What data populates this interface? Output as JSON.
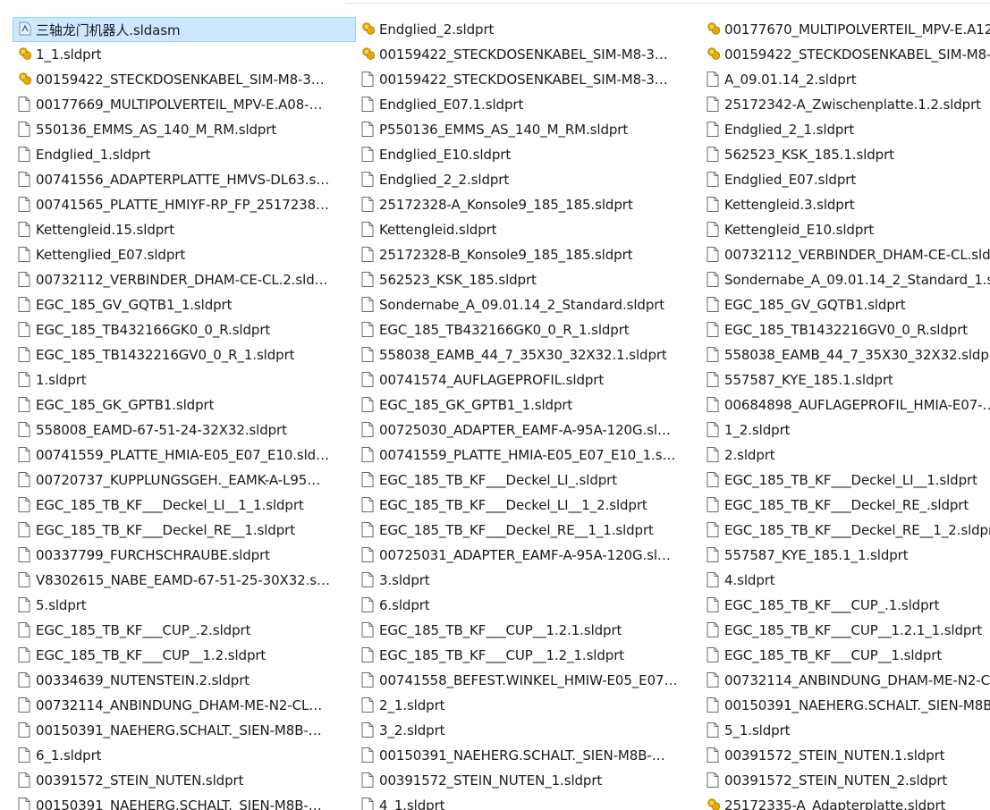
{
  "colors": {
    "selection_bg": "#cce8ff",
    "selection_border": "#99d1ff",
    "assembly_icon": "#e8a800",
    "part_icon_stroke": "#6b6b6b"
  },
  "files": [
    {
      "name": "三轴龙门机器人.sldasm",
      "icon": "assembly-file-icon",
      "selected": true
    },
    {
      "name": "1_1.sldprt",
      "icon": "assembly-file-icon"
    },
    {
      "name": "00159422_STECKDOSENKABEL_SIM-M8-3…",
      "icon": "assembly-file-icon"
    },
    {
      "name": "00177669_MULTIPOLVERTEIL_MPV-E.A08-…",
      "icon": "part-file-icon"
    },
    {
      "name": "550136_EMMS_AS_140_M_RM.sldprt",
      "icon": "part-file-icon"
    },
    {
      "name": "Endglied_1.sldprt",
      "icon": "part-file-icon"
    },
    {
      "name": "00741556_ADAPTERPLATTE_HMVS-DL63.s…",
      "icon": "part-file-icon"
    },
    {
      "name": "00741565_PLATTE_HMIYF-RP_FP_2517238…",
      "icon": "part-file-icon"
    },
    {
      "name": "Kettengleid.15.sldprt",
      "icon": "part-file-icon"
    },
    {
      "name": "Kettenglied_E07.sldprt",
      "icon": "part-file-icon"
    },
    {
      "name": "00732112_VERBINDER_DHAM-CE-CL.2.sld…",
      "icon": "part-file-icon"
    },
    {
      "name": "EGC_185_GV_GQTB1_1.sldprt",
      "icon": "part-file-icon"
    },
    {
      "name": "EGC_185_TB432166GK0_0_R.sldprt",
      "icon": "part-file-icon"
    },
    {
      "name": "EGC_185_TB1432216GV0_0_R_1.sldprt",
      "icon": "part-file-icon"
    },
    {
      "name": "1.sldprt",
      "icon": "part-file-icon"
    },
    {
      "name": "EGC_185_GK_GPTB1.sldprt",
      "icon": "part-file-icon"
    },
    {
      "name": "558008_EAMD-67-51-24-32X32.sldprt",
      "icon": "part-file-icon"
    },
    {
      "name": "00741559_PLATTE_HMIA-E05_E07_E10.sld…",
      "icon": "part-file-icon"
    },
    {
      "name": "00720737_KUPPLUNGSGEH._EAMK-A-L95…",
      "icon": "part-file-icon"
    },
    {
      "name": "EGC_185_TB_KF___Deckel_LI__1_1.sldprt",
      "icon": "part-file-icon"
    },
    {
      "name": "EGC_185_TB_KF___Deckel_RE__1.sldprt",
      "icon": "part-file-icon"
    },
    {
      "name": "00337799_FURCHSCHRAUBE.sldprt",
      "icon": "part-file-icon"
    },
    {
      "name": "V8302615_NABE_EAMD-67-51-25-30X32.s…",
      "icon": "part-file-icon"
    },
    {
      "name": "5.sldprt",
      "icon": "part-file-icon"
    },
    {
      "name": "EGC_185_TB_KF___CUP_.2.sldprt",
      "icon": "part-file-icon"
    },
    {
      "name": "EGC_185_TB_KF___CUP__1.2.sldprt",
      "icon": "part-file-icon"
    },
    {
      "name": "00334639_NUTENSTEIN.2.sldprt",
      "icon": "part-file-icon"
    },
    {
      "name": "00732114_ANBINDUNG_DHAM-ME-N2-CL…",
      "icon": "part-file-icon"
    },
    {
      "name": "00150391_NAEHERG.SCHALT._SIEN-M8B-…",
      "icon": "part-file-icon"
    },
    {
      "name": "6_1.sldprt",
      "icon": "part-file-icon"
    },
    {
      "name": "00391572_STEIN_NUTEN.sldprt",
      "icon": "part-file-icon"
    },
    {
      "name": "00150391_NAEHERG.SCHALT._SIEN-M8B-…",
      "icon": "part-file-icon"
    },
    {
      "name": "Endglied_2.sldprt",
      "icon": "assembly-file-icon"
    },
    {
      "name": "00159422_STECKDOSENKABEL_SIM-M8-3…",
      "icon": "assembly-file-icon"
    },
    {
      "name": "00159422_STECKDOSENKABEL_SIM-M8-3…",
      "icon": "part-file-icon"
    },
    {
      "name": "Endglied_E07.1.sldprt",
      "icon": "part-file-icon"
    },
    {
      "name": "P550136_EMMS_AS_140_M_RM.sldprt",
      "icon": "part-file-icon"
    },
    {
      "name": "Endglied_E10.sldprt",
      "icon": "part-file-icon"
    },
    {
      "name": "Endglied_2_2.sldprt",
      "icon": "part-file-icon"
    },
    {
      "name": "25172328-A_Konsole9_185_185.sldprt",
      "icon": "part-file-icon"
    },
    {
      "name": "Kettengleid.sldprt",
      "icon": "part-file-icon"
    },
    {
      "name": "25172328-B_Konsole9_185_185.sldprt",
      "icon": "part-file-icon"
    },
    {
      "name": "562523_KSK_185.sldprt",
      "icon": "part-file-icon"
    },
    {
      "name": "Sondernabe_A_09.01.14_2_Standard.sldprt",
      "icon": "part-file-icon"
    },
    {
      "name": "EGC_185_TB432166GK0_0_R_1.sldprt",
      "icon": "part-file-icon"
    },
    {
      "name": "558038_EAMB_44_7_35X30_32X32.1.sldprt",
      "icon": "part-file-icon"
    },
    {
      "name": "00741574_AUFLAGEPROFIL.sldprt",
      "icon": "part-file-icon"
    },
    {
      "name": "EGC_185_GK_GPTB1_1.sldprt",
      "icon": "part-file-icon"
    },
    {
      "name": "00725030_ADAPTER_EAMF-A-95A-120G.sl…",
      "icon": "part-file-icon"
    },
    {
      "name": "00741559_PLATTE_HMIA-E05_E07_E10_1.s…",
      "icon": "part-file-icon"
    },
    {
      "name": "EGC_185_TB_KF___Deckel_LI_.sldprt",
      "icon": "part-file-icon"
    },
    {
      "name": "EGC_185_TB_KF___Deckel_LI__1_2.sldprt",
      "icon": "part-file-icon"
    },
    {
      "name": "EGC_185_TB_KF___Deckel_RE__1_1.sldprt",
      "icon": "part-file-icon"
    },
    {
      "name": "00725031_ADAPTER_EAMF-A-95A-120G.sl…",
      "icon": "part-file-icon"
    },
    {
      "name": "3.sldprt",
      "icon": "part-file-icon"
    },
    {
      "name": "6.sldprt",
      "icon": "part-file-icon"
    },
    {
      "name": "EGC_185_TB_KF___CUP__1.2.1.sldprt",
      "icon": "part-file-icon"
    },
    {
      "name": "EGC_185_TB_KF___CUP__1.2_1.sldprt",
      "icon": "part-file-icon"
    },
    {
      "name": "00741558_BEFEST.WINKEL_HMIW-E05_E07…",
      "icon": "part-file-icon"
    },
    {
      "name": "2_1.sldprt",
      "icon": "part-file-icon"
    },
    {
      "name": "3_2.sldprt",
      "icon": "part-file-icon"
    },
    {
      "name": "00150391_NAEHERG.SCHALT._SIEN-M8B-…",
      "icon": "part-file-icon"
    },
    {
      "name": "00391572_STEIN_NUTEN_1.sldprt",
      "icon": "part-file-icon"
    },
    {
      "name": "4_1.sldprt",
      "icon": "part-file-icon"
    },
    {
      "name": "00177670_MULTIPOLVERTEIL_MPV-E.A12",
      "icon": "assembly-file-icon"
    },
    {
      "name": "00159422_STECKDOSENKABEL_SIM-M8-",
      "icon": "assembly-file-icon"
    },
    {
      "name": "A_09.01.14_2.sldprt",
      "icon": "part-file-icon"
    },
    {
      "name": "25172342-A_Zwischenplatte.1.2.sldprt",
      "icon": "part-file-icon"
    },
    {
      "name": "Endglied_2_1.sldprt",
      "icon": "part-file-icon"
    },
    {
      "name": "562523_KSK_185.1.sldprt",
      "icon": "part-file-icon"
    },
    {
      "name": "Endglied_E07.sldprt",
      "icon": "part-file-icon"
    },
    {
      "name": "Kettengleid.3.sldprt",
      "icon": "part-file-icon"
    },
    {
      "name": "Kettengleid_E10.sldprt",
      "icon": "part-file-icon"
    },
    {
      "name": "00732112_VERBINDER_DHAM-CE-CL.sldp",
      "icon": "part-file-icon"
    },
    {
      "name": "Sondernabe_A_09.01.14_2_Standard_1.sl",
      "icon": "part-file-icon"
    },
    {
      "name": "EGC_185_GV_GQTB1.sldprt",
      "icon": "part-file-icon"
    },
    {
      "name": "EGC_185_TB1432216GV0_0_R.sldprt",
      "icon": "part-file-icon"
    },
    {
      "name": "558038_EAMB_44_7_35X30_32X32.sldprt",
      "icon": "part-file-icon"
    },
    {
      "name": "557587_KYE_185.1.sldprt",
      "icon": "part-file-icon"
    },
    {
      "name": "00684898_AUFLAGEPROFIL_HMIA-E07-…",
      "icon": "part-file-icon"
    },
    {
      "name": "1_2.sldprt",
      "icon": "part-file-icon"
    },
    {
      "name": "2.sldprt",
      "icon": "part-file-icon"
    },
    {
      "name": "EGC_185_TB_KF___Deckel_LI__1.sldprt",
      "icon": "part-file-icon"
    },
    {
      "name": "EGC_185_TB_KF___Deckel_RE_.sldprt",
      "icon": "part-file-icon"
    },
    {
      "name": "EGC_185_TB_KF___Deckel_RE__1_2.sldpr",
      "icon": "part-file-icon"
    },
    {
      "name": "557587_KYE_185.1_1.sldprt",
      "icon": "part-file-icon"
    },
    {
      "name": "4.sldprt",
      "icon": "part-file-icon"
    },
    {
      "name": "EGC_185_TB_KF___CUP_.1.sldprt",
      "icon": "part-file-icon"
    },
    {
      "name": "EGC_185_TB_KF___CUP__1.2.1_1.sldprt",
      "icon": "part-file-icon"
    },
    {
      "name": "EGC_185_TB_KF___CUP__1.sldprt",
      "icon": "part-file-icon"
    },
    {
      "name": "00732114_ANBINDUNG_DHAM-ME-N2-C",
      "icon": "part-file-icon"
    },
    {
      "name": "00150391_NAEHERG.SCHALT._SIEN-M8B",
      "icon": "part-file-icon"
    },
    {
      "name": "5_1.sldprt",
      "icon": "part-file-icon"
    },
    {
      "name": "00391572_STEIN_NUTEN.1.sldprt",
      "icon": "part-file-icon"
    },
    {
      "name": "00391572_STEIN_NUTEN_2.sldprt",
      "icon": "part-file-icon"
    },
    {
      "name": "25172335-A_Adapterplatte.sldprt",
      "icon": "assembly-file-icon"
    }
  ]
}
